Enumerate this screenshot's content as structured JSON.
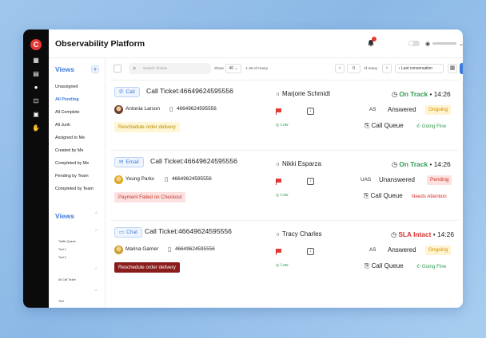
{
  "app": {
    "title": "Observability Platform",
    "logo": "C",
    "notification_count": "1"
  },
  "sidebar": {
    "views_title": "Views",
    "add": "+",
    "items": [
      "Unassigned",
      "All Pending",
      "All Complete",
      "All Junk",
      "Assigned to Me",
      "Created by Me",
      "Completed by Me",
      "Pending by Team",
      "Completed by Team"
    ],
    "active_index": 1,
    "views2_title": "Views",
    "group1": [
      "Traffic Queue",
      "Tool 1",
      "Tool 2"
    ],
    "group2_label": "All Call Ticket",
    "group3_label": "Tool"
  },
  "toolbar": {
    "search_placeholder": "Search Tickets",
    "show_label": "Show",
    "show_value": "40",
    "range": "1-40 of many",
    "page": "0",
    "of_many": "of many",
    "sort": "Last conversation"
  },
  "tickets": [
    {
      "channel": "Call",
      "channel_icon": "phone-icon",
      "ticket": "Call Ticket:46649624595556",
      "customer": "Antonia Larson",
      "phone": "46649624595556",
      "tag": "Reschedule order delivery",
      "tag_style": "y",
      "agent": "Marjorie Schmidt",
      "priority": "Low",
      "sla": "On Track",
      "sla_color": "#2e9b4f",
      "time": "14:26",
      "answered_by": "AS",
      "answered": "Answered",
      "state": "Ongoing",
      "state_style": "o",
      "queue": "Call Queue",
      "queue_status": "Going Fine",
      "queue_color": "#2e9b4f"
    },
    {
      "channel": "Email",
      "channel_icon": "mail-icon",
      "ticket": "Call Ticket:46649624595556",
      "customer": "Young Parks",
      "phone": "46649624595556",
      "tag": "Payment Failed on Checkout",
      "tag_style": "r",
      "agent": "Nikki Esparza",
      "priority": "Low",
      "sla": "On Track",
      "sla_color": "#2e9b4f",
      "time": "14:26",
      "answered_by": "UAS",
      "answered": "Unanswered",
      "state": "Pending",
      "state_style": "p",
      "queue": "Call Queue",
      "queue_status": "Needs Attention",
      "queue_color": "#d32f2f"
    },
    {
      "channel": "Chat",
      "channel_icon": "chat-icon",
      "ticket": "Call Ticket:46649624595556",
      "customer": "Marina Garner",
      "phone": "46649624595556",
      "tag": "Reschedule order delivery",
      "tag_style": "d",
      "agent": "Tracy Charles",
      "priority": "Low",
      "sla": "SLA Intact",
      "sla_color": "#d32f2f",
      "time": "14:26",
      "answered_by": "AS",
      "answered": "Answered",
      "state": "Ongoing",
      "state_style": "o",
      "queue": "Call Queue",
      "queue_status": "Going Fine",
      "queue_color": "#2e9b4f"
    }
  ]
}
